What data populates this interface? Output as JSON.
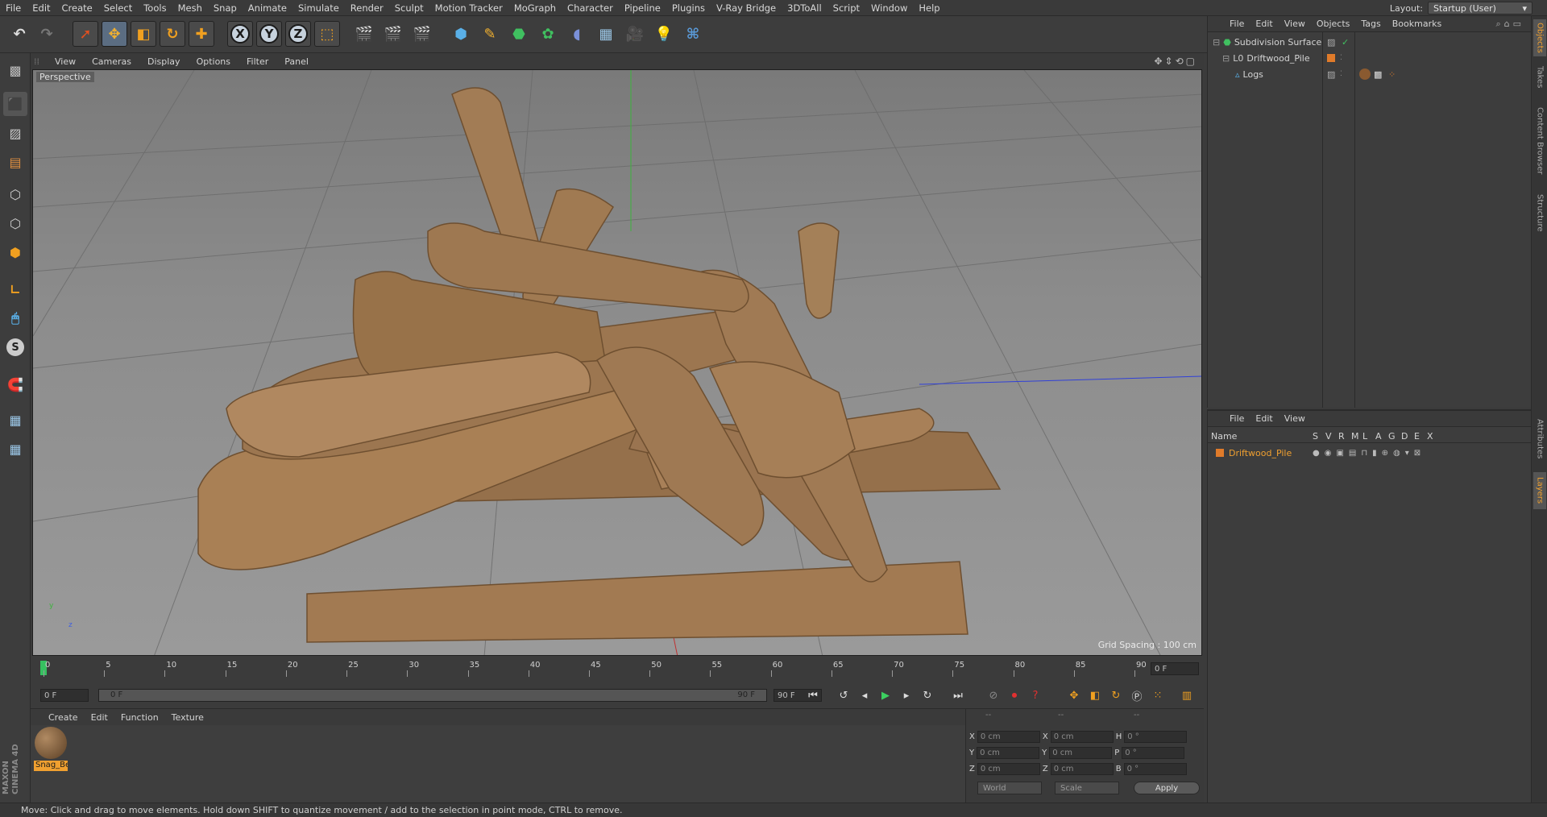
{
  "menubar": {
    "items": [
      "File",
      "Edit",
      "Create",
      "Select",
      "Tools",
      "Mesh",
      "Snap",
      "Animate",
      "Simulate",
      "Render",
      "Sculpt",
      "Motion Tracker",
      "MoGraph",
      "Character",
      "Pipeline",
      "Plugins",
      "V-Ray Bridge",
      "3DToAll",
      "Script",
      "Window",
      "Help"
    ],
    "layout_label": "Layout:",
    "layout_value": "Startup (User)"
  },
  "toolbar": {
    "x_label": "X",
    "y_label": "Y",
    "z_label": "Z"
  },
  "left_palette": {
    "s_label": "S"
  },
  "viewport": {
    "menu": [
      "View",
      "Cameras",
      "Display",
      "Options",
      "Filter",
      "Panel"
    ],
    "label": "Perspective",
    "grid_spacing": "Grid Spacing : 100 cm",
    "axis_y": "y",
    "axis_z": "z"
  },
  "timeline": {
    "ticks": [
      "0",
      "5",
      "10",
      "15",
      "20",
      "25",
      "30",
      "35",
      "40",
      "45",
      "50",
      "55",
      "60",
      "65",
      "70",
      "75",
      "80",
      "85",
      "90"
    ],
    "current_frame_field": "0 F",
    "start_field": "0 F",
    "range_start": "0 F",
    "range_end": "90 F",
    "end_field": "90 F"
  },
  "material_manager": {
    "menu": [
      "Create",
      "Edit",
      "Function",
      "Texture"
    ],
    "materials": [
      {
        "name": "Snag_Be"
      }
    ]
  },
  "coordinates": {
    "headers": [
      "--",
      "--",
      "--"
    ],
    "rows": [
      {
        "a": "X",
        "av": "0 cm",
        "b": "X",
        "bv": "0 cm",
        "c": "H",
        "cv": "0 °"
      },
      {
        "a": "Y",
        "av": "0 cm",
        "b": "Y",
        "bv": "0 cm",
        "c": "P",
        "cv": "0 °"
      },
      {
        "a": "Z",
        "av": "0 cm",
        "b": "Z",
        "bv": "0 cm",
        "c": "B",
        "cv": "0 °"
      }
    ],
    "mode1": "World",
    "mode2": "Scale",
    "apply": "Apply"
  },
  "object_manager": {
    "menu": [
      "File",
      "Edit",
      "View",
      "Objects",
      "Tags",
      "Bookmarks"
    ],
    "objects": [
      {
        "name": "Subdivision Surface",
        "color": "#d8d8d8"
      },
      {
        "name": "Driftwood_Pile",
        "color": "#d8d8d8"
      },
      {
        "name": "Logs",
        "color": "#d8d8d8"
      }
    ]
  },
  "layer_manager": {
    "menu": [
      "File",
      "Edit",
      "View"
    ],
    "columns": [
      "Name",
      "S",
      "V",
      "R",
      "M",
      "L",
      "A",
      "G",
      "D",
      "E",
      "X"
    ],
    "layers": [
      {
        "name": "Driftwood_Pile",
        "color": "#e07b2a"
      }
    ]
  },
  "side_tabs": [
    "Objects",
    "Takes",
    "Content Browser",
    "Structure",
    "Attributes",
    "Layers"
  ],
  "brand": {
    "maxon": "MAXON",
    "cinema": "CINEMA 4D"
  },
  "status": "Move: Click and drag to move elements. Hold down SHIFT to quantize movement / add to the selection in point mode, CTRL to remove.",
  "colors": {
    "accent": "#f0a030",
    "layer_orange": "#e07b2a",
    "wood": "#9c7650"
  }
}
